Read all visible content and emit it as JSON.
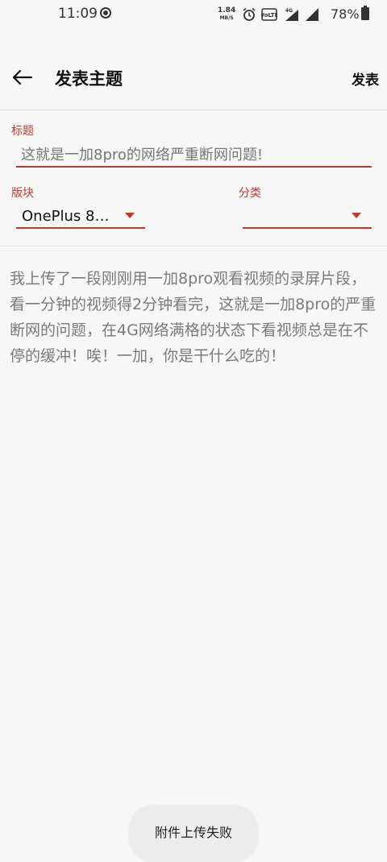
{
  "status_bar": {
    "time": "11:09",
    "net_speed_value": "1.84",
    "net_speed_unit": "MB/S",
    "volte_text": "VoLTE",
    "network_type": "4G",
    "battery_percent": "78%"
  },
  "app_bar": {
    "title": "发表主题",
    "publish_label": "发表"
  },
  "form": {
    "title_label": "标题",
    "title_value": "这就是一加8pro的网络严重断网问题!",
    "board_label": "版块",
    "board_value": "OnePlus 8…",
    "category_label": "分类",
    "category_value": "",
    "body_value": "我上传了一段刚刚用一加8pro观看视频的录屏片段，看一分钟的视频得2分钟看完，这就是一加8pro的严重断网的问题，在4G网络满格的状态下看视频总是在不停的缓冲！唉！一加，你是干什么吃的！"
  },
  "toast": {
    "message": "附件上传失败"
  },
  "colors": {
    "accent": "#c0392b",
    "background": "#f7f7f7"
  }
}
